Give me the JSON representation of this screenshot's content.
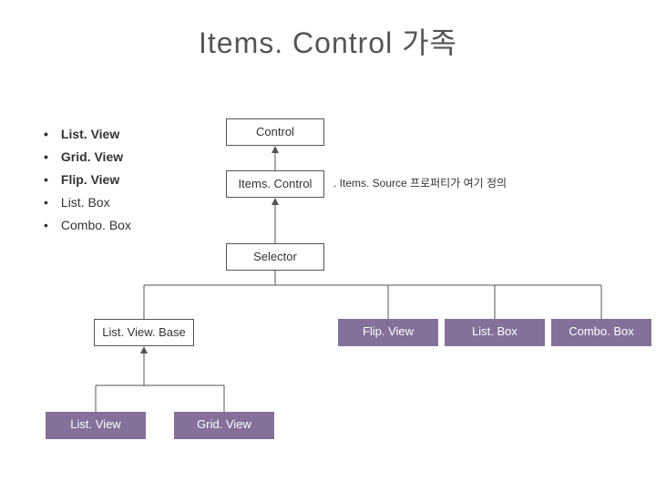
{
  "title": "Items. Control 가족",
  "bullets": [
    "List. View",
    "Grid. View",
    "Flip. View",
    "List. Box",
    "Combo. Box"
  ],
  "annotation": ". Items. Source 프로퍼티가 여기 정의",
  "chart_data": {
    "type": "diagram",
    "nodes": [
      {
        "id": "control",
        "label": "Control",
        "style": "outline"
      },
      {
        "id": "itemscontrol",
        "label": "Items. Control",
        "style": "outline"
      },
      {
        "id": "selector",
        "label": "Selector",
        "style": "outline"
      },
      {
        "id": "listviewbase",
        "label": "List. View. Base",
        "style": "outline"
      },
      {
        "id": "flipview",
        "label": "Flip. View",
        "style": "purple"
      },
      {
        "id": "listbox",
        "label": "List. Box",
        "style": "purple"
      },
      {
        "id": "combobox",
        "label": "Combo. Box",
        "style": "purple"
      },
      {
        "id": "listview",
        "label": "List. View",
        "style": "purple"
      },
      {
        "id": "gridview",
        "label": "Grid. View",
        "style": "purple"
      }
    ],
    "edges": [
      [
        "itemscontrol",
        "control"
      ],
      [
        "selector",
        "itemscontrol"
      ],
      [
        "listviewbase",
        "selector"
      ],
      [
        "flipview",
        "selector"
      ],
      [
        "listbox",
        "selector"
      ],
      [
        "combobox",
        "selector"
      ],
      [
        "listview",
        "listviewbase"
      ],
      [
        "gridview",
        "listviewbase"
      ]
    ],
    "colors": {
      "purple": "#847099",
      "outline": "#555555"
    }
  }
}
